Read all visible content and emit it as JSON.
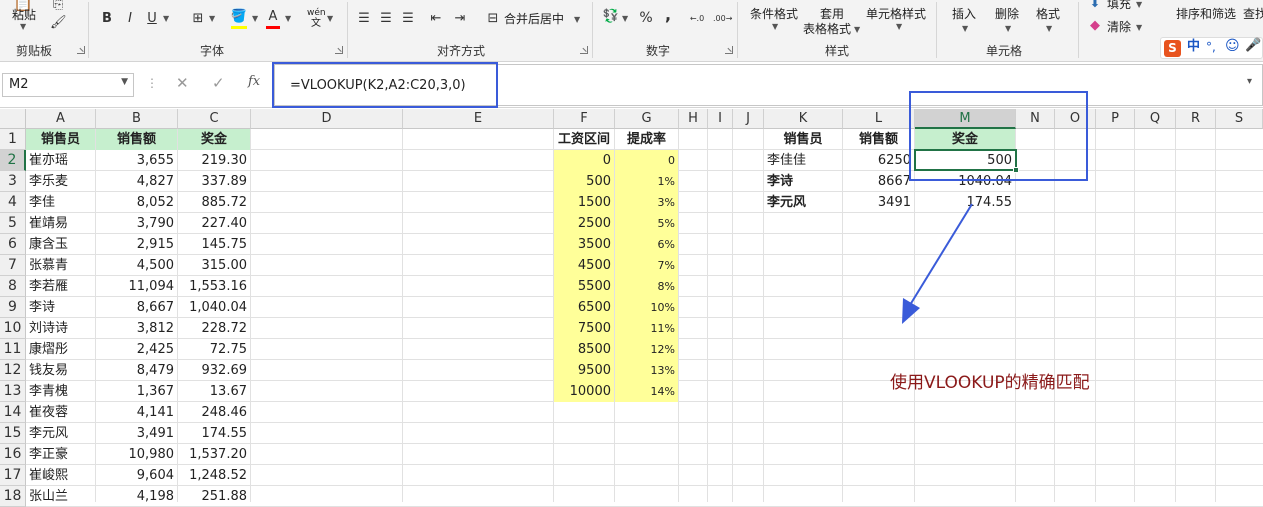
{
  "ribbon": {
    "paste": "粘贴",
    "clipboard": "剪贴板",
    "font": "字体",
    "align": "对齐方式",
    "merge_center": "合并后居中",
    "number": "数字",
    "percent": "%",
    "comma": ",",
    "cond_format": "条件格式",
    "table_format_1": "套用",
    "table_format_2": "表格格式",
    "cell_style": "单元格样式",
    "styles": "样式",
    "insert": "插入",
    "delete": "删除",
    "format": "格式",
    "cells": "单元格",
    "fill": "填充",
    "clear": "清除",
    "sort_filter": "排序和筛选",
    "find": "查找",
    "bold": "B",
    "italic": "I",
    "underline": "U",
    "font_color_letter": "A",
    "wen": "wén",
    "wen_char": "文",
    "ime_zh": "中",
    "ime_dot": "°,"
  },
  "colors": {
    "ribbon_bg": "#f3f3f3",
    "header_green": "#c6efce",
    "rate_yellow": "#ffff99",
    "annotation_blue": "#3a5bd9",
    "note_red": "#8b1a1a",
    "select_green": "#217346"
  },
  "formula_bar": {
    "name_box": "M2",
    "fx": "fx",
    "formula": "=VLOOKUP(K2,A2:C20,3,0)"
  },
  "columns": [
    "A",
    "B",
    "C",
    "D",
    "E",
    "F",
    "G",
    "H",
    "I",
    "J",
    "K",
    "L",
    "M",
    "N",
    "O",
    "P",
    "Q",
    "R",
    "S"
  ],
  "rows": [
    "1",
    "2",
    "3",
    "4",
    "5",
    "6",
    "7",
    "8",
    "9",
    "10",
    "11",
    "12",
    "13",
    "14",
    "15",
    "16",
    "17",
    "18"
  ],
  "table1": {
    "headers": [
      "销售员",
      "销售额",
      "奖金"
    ],
    "rows": [
      [
        "崔亦瑶",
        "3,655",
        "219.30"
      ],
      [
        "李乐麦",
        "4,827",
        "337.89"
      ],
      [
        "李佳",
        "8,052",
        "885.72"
      ],
      [
        "崔靖易",
        "3,790",
        "227.40"
      ],
      [
        "康含玉",
        "2,915",
        "145.75"
      ],
      [
        "张慕青",
        "4,500",
        "315.00"
      ],
      [
        "李若雁",
        "11,094",
        "1,553.16"
      ],
      [
        "李诗",
        "8,667",
        "1,040.04"
      ],
      [
        "刘诗诗",
        "3,812",
        "228.72"
      ],
      [
        "康熠彤",
        "2,425",
        "72.75"
      ],
      [
        "钱友易",
        "8,479",
        "932.69"
      ],
      [
        "李青槐",
        "1,367",
        "13.67"
      ],
      [
        "崔夜蓉",
        "4,141",
        "248.46"
      ],
      [
        "李元风",
        "3,491",
        "174.55"
      ],
      [
        "李正豪",
        "10,980",
        "1,537.20"
      ],
      [
        "崔峻熙",
        "9,604",
        "1,248.52"
      ],
      [
        "张山兰",
        "4,198",
        "251.88"
      ]
    ]
  },
  "table2": {
    "headers": [
      "工资区间",
      "提成率"
    ],
    "rows": [
      [
        "0",
        "0"
      ],
      [
        "500",
        "1%"
      ],
      [
        "1500",
        "3%"
      ],
      [
        "2500",
        "5%"
      ],
      [
        "3500",
        "6%"
      ],
      [
        "4500",
        "7%"
      ],
      [
        "5500",
        "8%"
      ],
      [
        "6500",
        "10%"
      ],
      [
        "7500",
        "11%"
      ],
      [
        "8500",
        "12%"
      ],
      [
        "9500",
        "13%"
      ],
      [
        "10000",
        "14%"
      ]
    ]
  },
  "table3": {
    "headers": [
      "销售员",
      "销售额",
      "奖金"
    ],
    "rows": [
      [
        "李佳佳",
        "6250",
        "500"
      ],
      [
        "李诗",
        "8667",
        "1040.04"
      ],
      [
        "李元风",
        "3491",
        "174.55"
      ]
    ]
  },
  "annotation": {
    "note": "使用VLOOKUP的精确匹配"
  }
}
